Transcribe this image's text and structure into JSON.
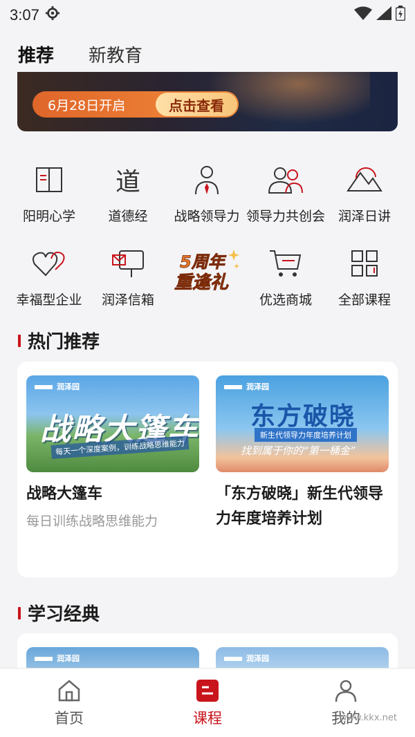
{
  "status_bar": {
    "time": "3:07",
    "icons": [
      "gear-icon",
      "wifi-icon",
      "signal-icon",
      "battery-icon"
    ]
  },
  "top_tabs": [
    {
      "label": "推荐",
      "active": true
    },
    {
      "label": "新教育",
      "active": false
    }
  ],
  "banner": {
    "date_text": "6月28日开启",
    "cta_label": "点击查看"
  },
  "grid": [
    {
      "label": "阳明心学",
      "icon": "book-icon"
    },
    {
      "label": "道德经",
      "icon": "dao-char-icon"
    },
    {
      "label": "战略领导力",
      "icon": "leader-icon"
    },
    {
      "label": "领导力共创会",
      "icon": "people-icon"
    },
    {
      "label": "润泽日讲",
      "icon": "mountain-icon"
    },
    {
      "label": "幸福型企业",
      "icon": "heart-icon"
    },
    {
      "label": "润泽信箱",
      "icon": "mailbox-icon"
    },
    {
      "label": "5周年重逢礼",
      "icon": "anniversary-badge"
    },
    {
      "label": "优选商城",
      "icon": "cart-icon"
    },
    {
      "label": "全部课程",
      "icon": "grid-icon"
    }
  ],
  "sections": {
    "hot": {
      "title": "热门推荐"
    },
    "classic": {
      "title": "学习经典"
    }
  },
  "hot_courses": [
    {
      "brand": "润泽园",
      "thumb_title": "战略大篷车",
      "thumb_slogan": "每天一个深度案例，训练战略思维能力",
      "title": "战略大篷车",
      "subtitle": "每日训练战略思维能力"
    },
    {
      "brand": "润泽园",
      "thumb_title": "东方破晓",
      "thumb_tag": "新生代领导力年度培养计划",
      "thumb_script": "找到属于你的“第一桶金”",
      "title": "「东方破晓」新生代领导力年度培养计划",
      "subtitle": ""
    }
  ],
  "classic_courses": [
    {
      "brand": "润泽园"
    },
    {
      "brand": "润泽园"
    }
  ],
  "bottom_nav": [
    {
      "label": "首页",
      "icon": "home-icon",
      "active": false
    },
    {
      "label": "课程",
      "icon": "course-icon",
      "active": true
    },
    {
      "label": "我的",
      "icon": "person-icon",
      "active": false
    }
  ],
  "watermark": "www.kkx.net",
  "colors": {
    "accent": "#c9141c",
    "page_bg": "#f4f4f6"
  }
}
